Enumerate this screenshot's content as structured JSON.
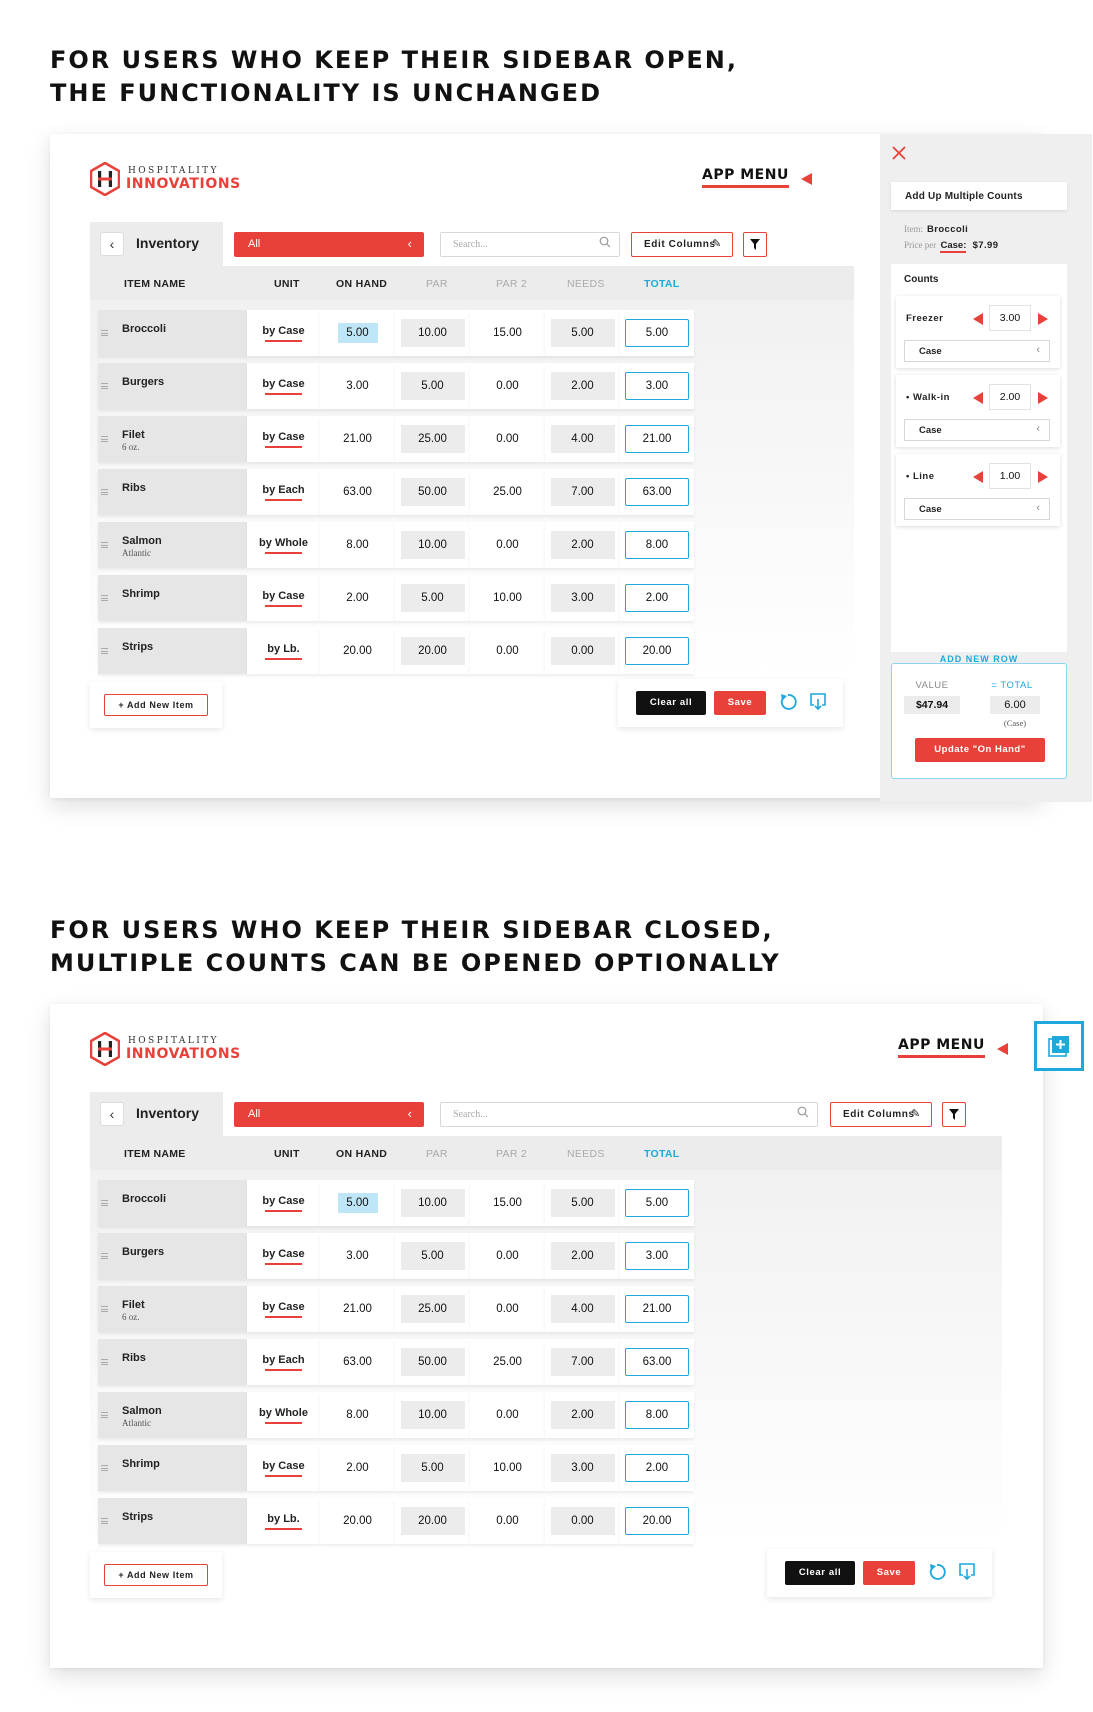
{
  "headline1": {
    "line1": "FOR USERS WHO KEEP THEIR SIDEBAR OPEN,",
    "line2": "THE FUNCTIONALITY IS UNCHANGED"
  },
  "headline2": {
    "line1": "FOR USERS WHO KEEP THEIR SIDEBAR CLOSED,",
    "line2": "MULTIPLE COUNTS CAN BE OPENED OPTIONALLY"
  },
  "brand": {
    "line1": "HOSPITALITY",
    "line2": "INNOVATIONS",
    "accent": "#e8413a"
  },
  "app_menu": "APP MENU",
  "toolbar": {
    "back_icon": "chevron-left-icon",
    "title": "Inventory",
    "filter_value": "All",
    "search_placeholder": "Search...",
    "edit_columns": "Edit Columns",
    "filter_icon": "funnel-icon"
  },
  "columns": {
    "item_name": "ITEM NAME",
    "unit": "UNIT",
    "on_hand": "ON HAND",
    "par": "PAR",
    "par2": "PAR 2",
    "needs": "NEEDS",
    "total": "TOTAL"
  },
  "rows": [
    {
      "name": "Broccoli",
      "sub": "",
      "unit": "by Case",
      "on_hand": "5.00",
      "par": "10.00",
      "par2": "15.00",
      "needs": "5.00",
      "total": "5.00"
    },
    {
      "name": "Burgers",
      "sub": "",
      "unit": "by Case",
      "on_hand": "3.00",
      "par": "5.00",
      "par2": "0.00",
      "needs": "2.00",
      "total": "3.00"
    },
    {
      "name": "Filet",
      "sub": "6 oz.",
      "unit": "by Case",
      "on_hand": "21.00",
      "par": "25.00",
      "par2": "0.00",
      "needs": "4.00",
      "total": "21.00"
    },
    {
      "name": "Ribs",
      "sub": "",
      "unit": "by Each",
      "on_hand": "63.00",
      "par": "50.00",
      "par2": "25.00",
      "needs": "7.00",
      "total": "63.00"
    },
    {
      "name": "Salmon",
      "sub": "Atlantic",
      "unit": "by Whole",
      "on_hand": "8.00",
      "par": "10.00",
      "par2": "0.00",
      "needs": "2.00",
      "total": "8.00"
    },
    {
      "name": "Shrimp",
      "sub": "",
      "unit": "by Case",
      "on_hand": "2.00",
      "par": "5.00",
      "par2": "10.00",
      "needs": "3.00",
      "total": "2.00"
    },
    {
      "name": "Strips",
      "sub": "",
      "unit": "by Lb.",
      "on_hand": "20.00",
      "par": "20.00",
      "par2": "0.00",
      "needs": "0.00",
      "total": "20.00"
    }
  ],
  "footer": {
    "add_item": "+ Add New Item",
    "clear_all": "Clear all",
    "save": "Save",
    "undo_icon": "undo-icon",
    "download_icon": "download-icon"
  },
  "sidebar": {
    "title": "Add Up Multiple Counts",
    "item_label": "Item:",
    "item_value": "Broccoli",
    "price_label": "Price per",
    "price_unit": "Case:",
    "price_value": "$7.99",
    "counts_label": "Counts",
    "counts": [
      {
        "name": "Freezer",
        "value": "3.00",
        "unit": "Case"
      },
      {
        "name": "• Walk-in",
        "value": "2.00",
        "unit": "Case"
      },
      {
        "name": "• Line",
        "value": "1.00",
        "unit": "Case"
      }
    ],
    "add_row": "ADD NEW ROW",
    "value_label": "VALUE",
    "value": "$47.94",
    "total_label": "= TOTAL",
    "total": "6.00",
    "total_unit": "(Case)",
    "update_button": "Update \"On Hand\""
  },
  "colors": {
    "accent_red": "#e8413a",
    "accent_blue": "#1ea8dc",
    "highlight": "#bfe6f7"
  }
}
